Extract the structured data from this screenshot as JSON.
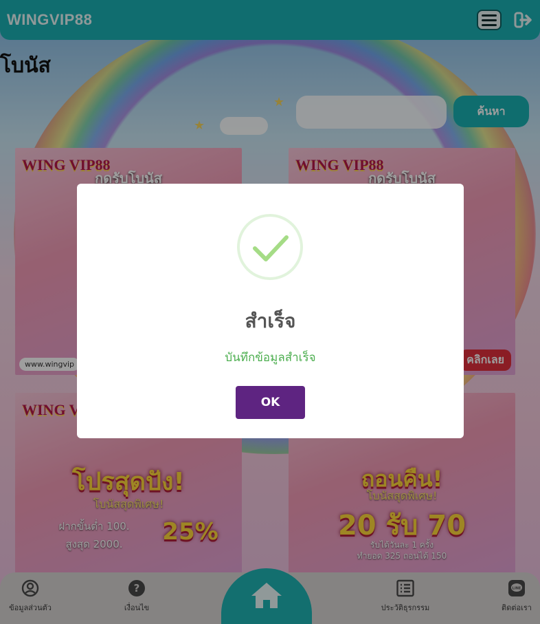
{
  "header": {
    "logo": "WINGVIP88",
    "menu_icon": "hamburger-menu-icon",
    "logout_icon": "logout-icon",
    "accent": "#1ab0b3"
  },
  "page": {
    "title": "โบนัส"
  },
  "search": {
    "value": "",
    "placeholder": "",
    "button_label": "ค้นหา"
  },
  "cards": [
    {
      "brand": "WING VIP88",
      "title": "กดรับโบนัส",
      "headline": "",
      "footer": "www.wingvip",
      "pill": ""
    },
    {
      "brand": "WING VIP88",
      "title": "กดรับโบนัส",
      "headline": "",
      "footer": "",
      "pill": "คลิกเลย"
    },
    {
      "brand": "WING VIP88",
      "title": "",
      "headline": "โปรสุดปัง!",
      "sub": "โบนัสสุดพิเศษ!",
      "detail1": "ฝากขั้นต่ำ 100.",
      "detail2": "สูงสุด 2000.",
      "bonus": "25%"
    },
    {
      "brand": "",
      "title": "",
      "headline": "ถอนคืน!",
      "sub": "โบนัสสุดพิเศษ!",
      "big": "20 รับ 70",
      "detail1": "รับได้วันละ 1 ครั้ง",
      "detail2": "ทำยอด 325 ถอนได้ 150"
    }
  ],
  "modal": {
    "icon": "success-check-icon",
    "title": "สำเร็จ",
    "message": "บันทึกข้อมูลสำเร็จ",
    "ok_label": "OK",
    "ok_color": "#5e2481",
    "message_color": "#4cae4f"
  },
  "bottom_nav": {
    "items": [
      {
        "label": "ข้อมูลส่วนตัว",
        "icon": "user-circle-icon"
      },
      {
        "label": "เงื่อนไข",
        "icon": "question-circle-icon"
      },
      {
        "label": "",
        "icon": "home-icon"
      },
      {
        "label": "ประวัติธุรกรรม",
        "icon": "list-icon"
      },
      {
        "label": "ติดต่อเรา",
        "icon": "line-chat-icon"
      }
    ]
  }
}
